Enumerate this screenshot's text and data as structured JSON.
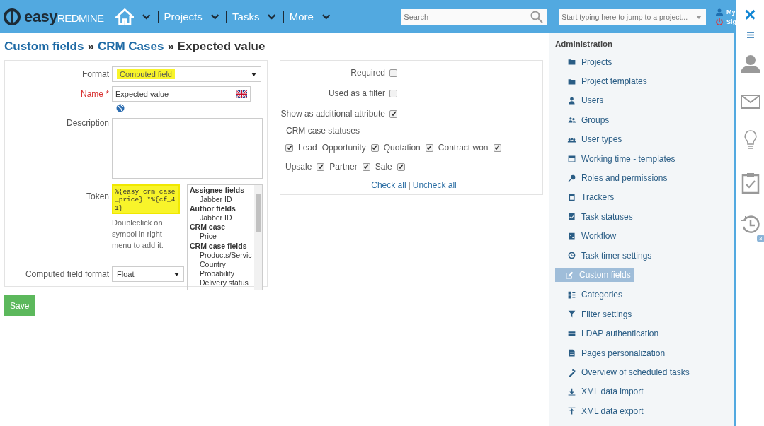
{
  "header": {
    "logo_bold": "easy",
    "logo_light": "REDMINE",
    "menu": [
      {
        "label": "Projects"
      },
      {
        "label": "Tasks"
      },
      {
        "label": "More"
      }
    ],
    "search": {
      "placeholder": "Search"
    },
    "jump": {
      "placeholder": "Start typing here to jump to a project..."
    },
    "user_links": [
      "My",
      "Sig"
    ]
  },
  "breadcrumb": [
    {
      "label": "Custom fields",
      "link": true
    },
    {
      "label": "»",
      "link": false
    },
    {
      "label": "CRM Cases",
      "link": true
    },
    {
      "label": "» Expected value",
      "link": false
    }
  ],
  "form": {
    "format_label": "Format",
    "format_value": "Computed field",
    "name_label": "Name",
    "name_required": "*",
    "name_value": "Expected value",
    "description_label": "Description",
    "token_label": "Token",
    "token_value": "%{easy_crm_case_price} *%{cf_41}",
    "token_hint": "Doubleclick on symbol in right menu to add it.",
    "computed_format_label": "Computed field format",
    "computed_format_value": "Float",
    "symbols": [
      {
        "kind": "group",
        "label": "Assignee fields"
      },
      {
        "kind": "item",
        "label": "Jabber ID"
      },
      {
        "kind": "group",
        "label": "Author fields"
      },
      {
        "kind": "item",
        "label": "Jabber ID"
      },
      {
        "kind": "group",
        "label": "CRM case"
      },
      {
        "kind": "item",
        "label": "Price"
      },
      {
        "kind": "group",
        "label": "CRM case fields"
      },
      {
        "kind": "item",
        "label": "Products/Servic"
      },
      {
        "kind": "item",
        "label": "Country"
      },
      {
        "kind": "item",
        "label": "Probability"
      },
      {
        "kind": "item",
        "label": "Delivery status"
      }
    ]
  },
  "options": [
    {
      "label": "Required",
      "checked": false
    },
    {
      "label": "Used as a filter",
      "checked": false
    },
    {
      "label": "Show as additional attribute",
      "checked": true
    }
  ],
  "statuses": {
    "legend": "CRM case statuses",
    "items": [
      {
        "label": "Lead",
        "checked": true
      },
      {
        "label": "Opportunity",
        "checked": true
      },
      {
        "label": "Quotation",
        "checked": true
      },
      {
        "label": "Contract won",
        "checked": true
      },
      {
        "label": "Upsale",
        "checked": true
      },
      {
        "label": "Partner",
        "checked": true
      },
      {
        "label": "Sale",
        "checked": true
      }
    ],
    "check_all": "Check all",
    "separator": "|",
    "uncheck_all": "Uncheck all"
  },
  "save": "Save",
  "sidebar": {
    "title": "Administration",
    "items": [
      {
        "label": "Projects",
        "selected": false
      },
      {
        "label": "Project templates",
        "selected": false
      },
      {
        "label": "Users",
        "selected": false
      },
      {
        "label": "Groups",
        "selected": false
      },
      {
        "label": "User types",
        "selected": false
      },
      {
        "label": "Working time - templates",
        "selected": false
      },
      {
        "label": "Roles and permissions",
        "selected": false
      },
      {
        "label": "Trackers",
        "selected": false
      },
      {
        "label": "Task statuses",
        "selected": false
      },
      {
        "label": "Workflow",
        "selected": false
      },
      {
        "label": "Task timer settings",
        "selected": false
      },
      {
        "label": "Custom fields",
        "selected": true
      },
      {
        "label": "Categories",
        "selected": false
      },
      {
        "label": "Filter settings",
        "selected": false
      },
      {
        "label": "LDAP authentication",
        "selected": false
      },
      {
        "label": "Pages personalization",
        "selected": false
      },
      {
        "label": "Overview of scheduled tasks",
        "selected": false
      },
      {
        "label": "XML data import",
        "selected": false
      },
      {
        "label": "XML data export",
        "selected": false
      }
    ]
  },
  "rail": {
    "close": "×",
    "timer_badge": "3"
  }
}
